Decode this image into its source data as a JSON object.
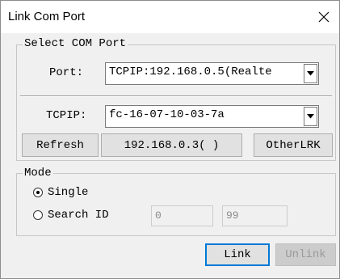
{
  "window": {
    "title": "Link Com Port"
  },
  "select_com_port": {
    "legend": "Select COM Port",
    "port_label": "Port:",
    "port_value": "TCPIP:192.168.0.5(Realte",
    "tcpip_label": "TCPIP:",
    "tcpip_value": "fc-16-07-10-03-7a",
    "refresh_label": "Refresh",
    "address_label": "192.168.0.3( )",
    "other_label": "OtherLRK"
  },
  "mode": {
    "legend": "Mode",
    "single_label": "Single",
    "single_checked": true,
    "search_label": "Search ID",
    "search_checked": false,
    "search_from": "0",
    "search_to": "99"
  },
  "footer": {
    "link_label": "Link",
    "unlink_label": "Unlink"
  },
  "icons": {
    "close": "close-icon",
    "dropdown": "chevron-down-icon"
  }
}
